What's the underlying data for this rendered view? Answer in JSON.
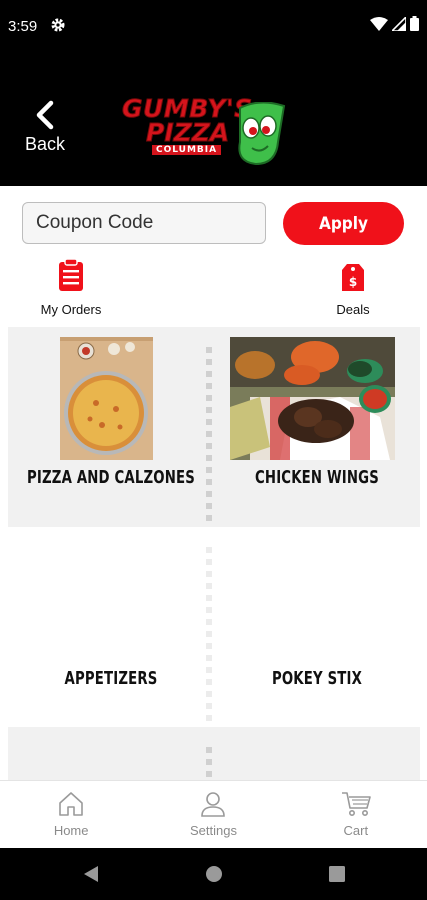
{
  "status_bar": {
    "time": "3:59"
  },
  "header": {
    "back_label": "Back",
    "logo": {
      "line1": "GUMBY'S",
      "line2": "PIZZA",
      "subline": "COLUMBIA"
    }
  },
  "coupon": {
    "placeholder": "Coupon Code",
    "apply_label": "Apply"
  },
  "quick_links": [
    {
      "label": "My Orders",
      "icon": "clipboard-list-icon"
    },
    {
      "label": "Deals",
      "icon": "price-tag-icon"
    }
  ],
  "categories": [
    {
      "label": "PIZZA AND CALZONES"
    },
    {
      "label": "CHICKEN WINGS"
    },
    {
      "label": "APPETIZERS"
    },
    {
      "label": "POKEY STIX"
    }
  ],
  "bottom_nav": [
    {
      "label": "Home",
      "icon": "home-icon"
    },
    {
      "label": "Settings",
      "icon": "person-icon"
    },
    {
      "label": "Cart",
      "icon": "cart-icon"
    }
  ],
  "colors": {
    "brand_red": "#f0111a",
    "header_bg": "#000000",
    "tile_shade": "#f1f1f1"
  }
}
